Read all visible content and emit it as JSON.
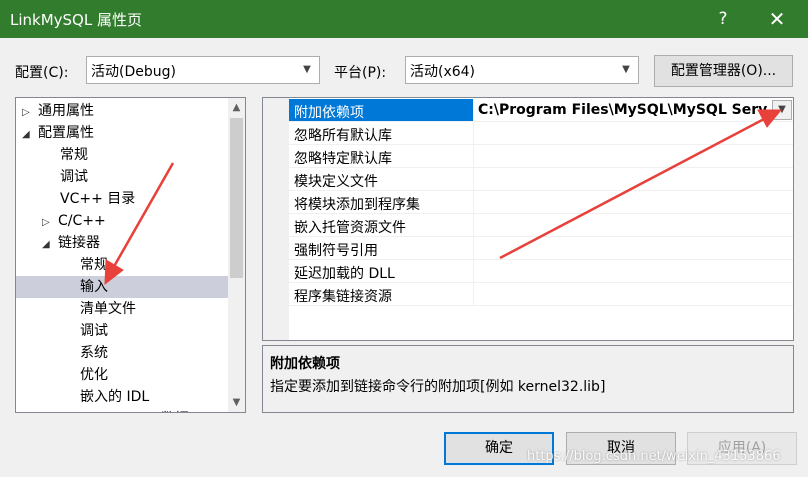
{
  "window": {
    "title": "LinkMySQL 属性页",
    "help_glyph": "?",
    "close_glyph": "✕"
  },
  "toolbar": {
    "config_label": "配置(C):",
    "config_value": "活动(Debug)",
    "platform_label": "平台(P):",
    "platform_value": "活动(x64)",
    "config_manager_label": "配置管理器(O)..."
  },
  "tree": {
    "items": [
      {
        "label": "通用属性",
        "expander": "▷"
      },
      {
        "label": "配置属性",
        "expander": "◢"
      },
      {
        "label": "常规",
        "expander": ""
      },
      {
        "label": "调试",
        "expander": ""
      },
      {
        "label": "VC++ 目录",
        "expander": ""
      },
      {
        "label": "C/C++",
        "expander": "▷"
      },
      {
        "label": "链接器",
        "expander": "◢"
      },
      {
        "label": "常规",
        "expander": ""
      },
      {
        "label": "输入",
        "expander": ""
      },
      {
        "label": "清单文件",
        "expander": ""
      },
      {
        "label": "调试",
        "expander": ""
      },
      {
        "label": "系统",
        "expander": ""
      },
      {
        "label": "优化",
        "expander": ""
      },
      {
        "label": "嵌入的 IDL",
        "expander": ""
      },
      {
        "label": "Windows 元数据",
        "expander": ""
      }
    ],
    "selected_index": 8
  },
  "grid": {
    "rows": [
      {
        "name": "附加依赖项",
        "value": "C:\\Program Files\\MySQL\\MySQL Server"
      },
      {
        "name": "忽略所有默认库",
        "value": ""
      },
      {
        "name": "忽略特定默认库",
        "value": ""
      },
      {
        "name": "模块定义文件",
        "value": ""
      },
      {
        "name": "将模块添加到程序集",
        "value": ""
      },
      {
        "name": "嵌入托管资源文件",
        "value": ""
      },
      {
        "name": "强制符号引用",
        "value": ""
      },
      {
        "name": "延迟加载的 DLL",
        "value": ""
      },
      {
        "name": "程序集链接资源",
        "value": ""
      }
    ],
    "selected_index": 0
  },
  "description": {
    "title": "附加依赖项",
    "text": "指定要添加到链接命令行的附加项[例如 kernel32.lib]"
  },
  "buttons": {
    "ok": "确定",
    "cancel": "取消",
    "apply": "应用(A)"
  },
  "watermark": "https://blog.csdn.net/weixin_43153866",
  "colors": {
    "titlebar": "#317c2d",
    "selection": "#0078d7",
    "tree_selection": "#cccedb",
    "annotation_arrow": "#e8403a"
  }
}
